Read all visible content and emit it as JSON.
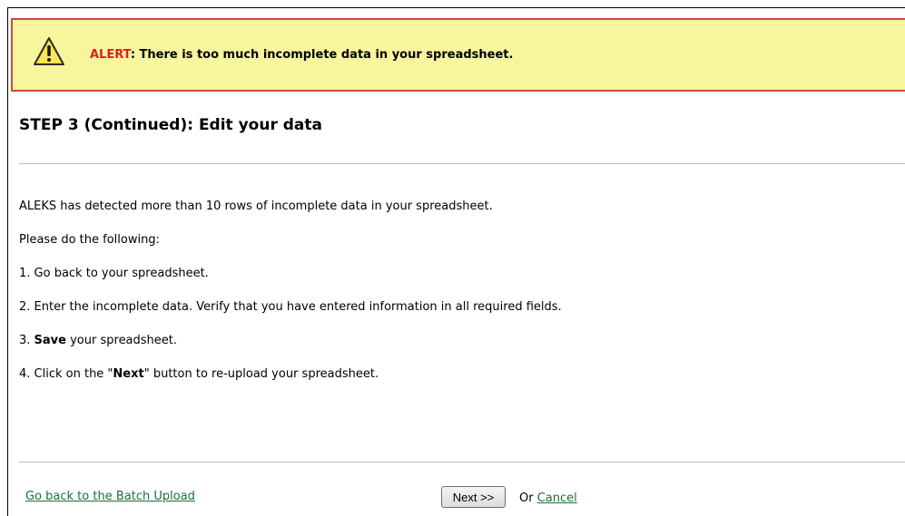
{
  "alert": {
    "label": "ALERT",
    "message": ": There is too much incomplete data in your spreadsheet.",
    "icon": "warning-icon",
    "background_color": "#f7f59e",
    "border_color": "#c94a3f",
    "label_color": "#e11d1d"
  },
  "step": {
    "title": "STEP 3 (Continued): Edit your data"
  },
  "body": {
    "detected": "ALEKS has detected more than 10 rows of incomplete data in your spreadsheet.",
    "instructions_intro": "Please do the following:",
    "step1": "1. Go back to your spreadsheet.",
    "step2": "2. Enter the incomplete data. Verify that you have entered information in all required fields.",
    "step3_prefix": "3. ",
    "step3_bold": "Save",
    "step3_suffix": " your spreadsheet.",
    "step4_prefix": "4. Click on the \"",
    "step4_bold": "Next",
    "step4_suffix": "\" button to re-upload your spreadsheet."
  },
  "footer": {
    "back_link": "Go back to the Batch Upload",
    "next_button": "Next >>",
    "or_text": "Or",
    "cancel_link": "Cancel",
    "link_color": "#1a6e3a"
  }
}
